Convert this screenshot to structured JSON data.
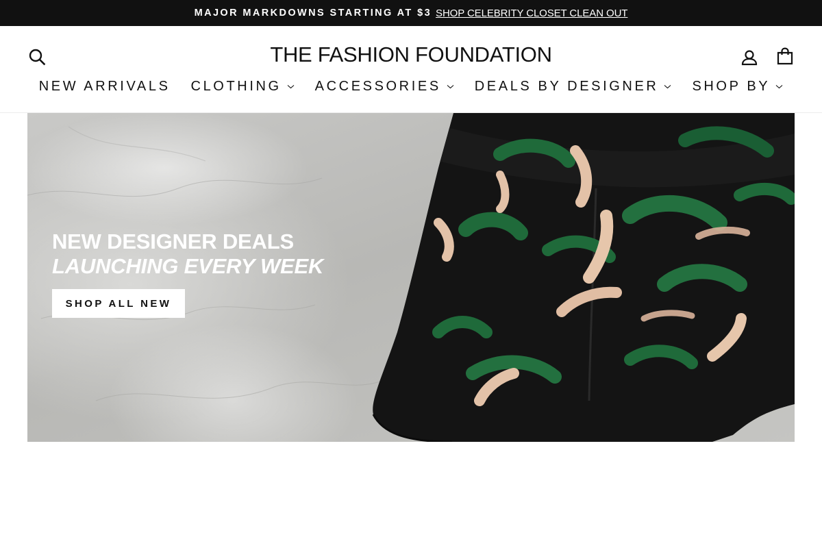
{
  "announcement": {
    "message": "MAJOR MARKDOWNS STARTING AT $3",
    "link_label": "SHOP CELEBRITY CLOSET CLEAN OUT"
  },
  "header": {
    "logo": "THE FASHION FOUNDATION",
    "icons": {
      "search": "search-icon",
      "account": "account-icon",
      "cart": "cart-icon"
    }
  },
  "nav": {
    "items": [
      {
        "label": "NEW ARRIVALS",
        "has_dropdown": false
      },
      {
        "label": "CLOTHING",
        "has_dropdown": true
      },
      {
        "label": "ACCESSORIES",
        "has_dropdown": true
      },
      {
        "label": "DEALS BY DESIGNER",
        "has_dropdown": true
      },
      {
        "label": "SHOP BY",
        "has_dropdown": true
      }
    ]
  },
  "hero": {
    "title": "NEW DESIGNER DEALS",
    "subtitle": "LAUNCHING EVERY WEEK",
    "cta_label": "SHOP ALL NEW"
  },
  "colors": {
    "announcement_bg": "#111111",
    "text": "#111111",
    "shorts_base": "#141414",
    "stroke_green": "#1f6a3a",
    "stroke_tan": "#e3c2a8"
  }
}
